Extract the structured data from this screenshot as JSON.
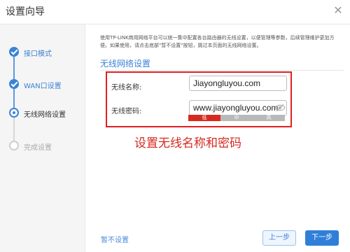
{
  "window": {
    "title": "设置向导",
    "close_glyph": "✕"
  },
  "steps": [
    {
      "label": "接口模式",
      "state": "done"
    },
    {
      "label": "WAN口设置",
      "state": "done"
    },
    {
      "label": "无线网络设置",
      "state": "current"
    },
    {
      "label": "完成设置",
      "state": "todo"
    }
  ],
  "content": {
    "description": "使用TP-LINK商用网络平台可以统一集中配置各台路由器的无线设置，以便管理等参数，后续管理维护更加方便。如果使用，请点击底部\"暂不设置\"按钮，跳过本页面的无线网络设置。",
    "section_title": "无线网络设置",
    "ssid_label": "无线名称:",
    "ssid_value": "Jiayongluyou.com",
    "password_label": "无线密码:",
    "password_value": "www.jiayongluyou.com",
    "strength": {
      "weak": "低",
      "medium": "中",
      "strong": "高",
      "level": "weak"
    },
    "annotation": "设置无线名称和密码"
  },
  "footer": {
    "skip_label": "暂不设置",
    "prev_label": "上一步",
    "next_label": "下一步"
  },
  "colors": {
    "accent": "#3b82d6",
    "highlight_red": "#e02020",
    "strength_weak": "#d62a20"
  },
  "icons": {
    "close": "close-icon",
    "password_visibility": "eye-icon",
    "step_done": "check-icon"
  }
}
